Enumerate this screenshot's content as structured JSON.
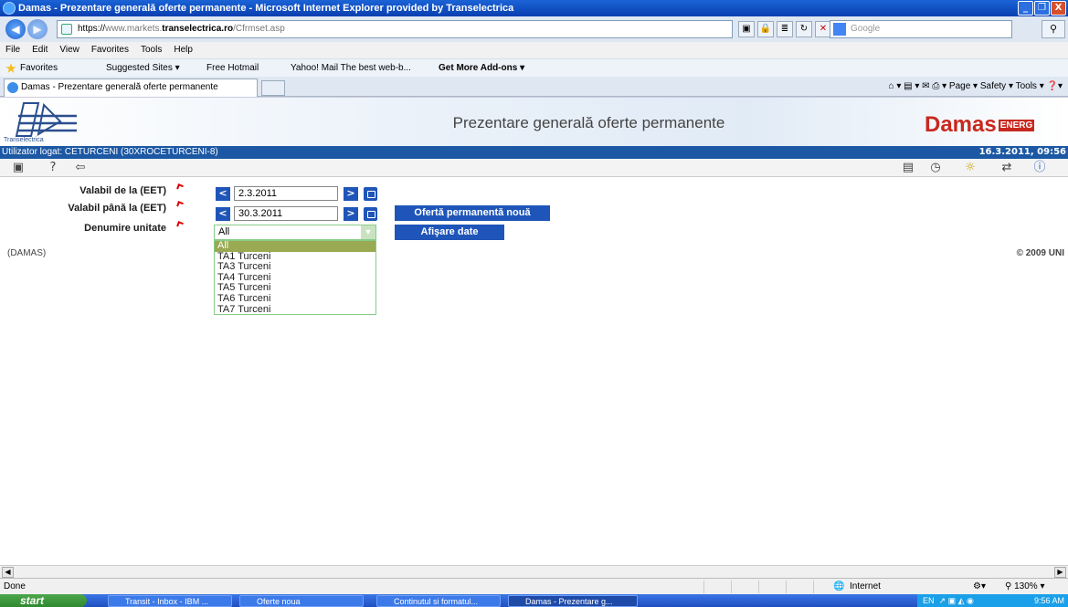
{
  "window": {
    "title": "Damas - Prezentare generală oferte permanente - Microsoft Internet Explorer provided by Transelectrica",
    "btn_min": "_",
    "btn_max": "❐",
    "btn_close": "X"
  },
  "address": {
    "url_scheme": "https://",
    "url_sub": "www.markets.",
    "url_domain": "transelectrica.ro",
    "url_path": "/Cfrmset.asp",
    "search_placeholder": "Google"
  },
  "menu": [
    "File",
    "Edit",
    "View",
    "Favorites",
    "Tools",
    "Help"
  ],
  "favorites": {
    "label": "Favorites",
    "items": [
      "Suggested Sites ▾",
      "Free Hotmail",
      "Yahoo! Mail The best web-b...",
      "Get More Add-ons ▾"
    ]
  },
  "tab": {
    "label": "Damas - Prezentare generală oferte permanente"
  },
  "commands": "Page ▾   Safety ▾   Tools ▾",
  "header": {
    "logo_caption": "Transelectrica",
    "title": "Prezentare generală oferte permanente",
    "brand": "Damas",
    "brand_tag": "ENERG"
  },
  "userbar": {
    "user": "Utilizator logat: CETURCENI (30XROCETURCENI-8)",
    "datetime": "16.3.2011, 09:56"
  },
  "form": {
    "valid_from_label": "Valabil de la (EET)",
    "valid_to_label": "Valabil până la (EET)",
    "unit_label": "Denumire unitate",
    "valid_from": "2.3.2011",
    "valid_to": "30.3.2011",
    "unit_selected": "All",
    "new_offer_button": "Ofertă permanentă nouă",
    "show_data_button": "Afişare date",
    "prev": "<",
    "next": ">"
  },
  "unit_options": [
    "All",
    "TA1 Turceni",
    "TA3 Turceni",
    "TA4 Turceni",
    "TA5 Turceni",
    "TA6 Turceni",
    "TA7 Turceni"
  ],
  "footer": {
    "left": "(DAMAS)",
    "right": "© 2009 UNI"
  },
  "status": {
    "left": "Done",
    "zone": "Internet",
    "zoom": "130%"
  },
  "taskbar": {
    "start": "start",
    "tasks": [
      "Transit - Inbox - IBM ...",
      "Oferte noua",
      "Continutul si formatul...",
      "Damas - Prezentare g..."
    ],
    "lang": "EN",
    "clock": "9:56 AM"
  }
}
